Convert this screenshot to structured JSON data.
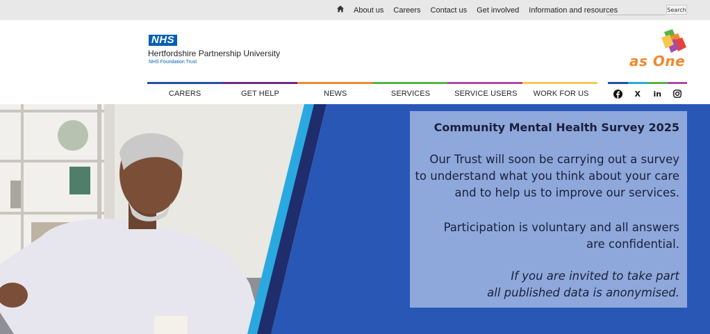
{
  "topbar": {
    "links": [
      "About us",
      "Careers",
      "Contact us",
      "Get involved",
      "Information and resources"
    ],
    "search_placeholder": "",
    "search_button": "Search"
  },
  "header": {
    "nhs_logo": "NHS",
    "org_name": "Hertfordshire Partnership University",
    "org_sub": "NHS Foundation Trust",
    "partner_logo": "as One"
  },
  "colors": {
    "bar": [
      "#2151a6",
      "#6d2a84",
      "#ef8a2c",
      "#57b345",
      "#a64ca6",
      "#f6c851"
    ],
    "bar2": [
      "#2151a6",
      "#2aa9e0",
      "#57b345",
      "#a64ca6"
    ],
    "hero_bg": "#2857b6",
    "panel_bg": "#8ea8db",
    "stripe": "#2aa9e0"
  },
  "nav": {
    "items": [
      "CARERS",
      "GET HELP",
      "NEWS",
      "SERVICES",
      "SERVICE USERS",
      "WORK FOR US"
    ]
  },
  "social": {
    "icons": [
      "facebook-icon",
      "x-icon",
      "linkedin-icon",
      "instagram-icon"
    ],
    "labels": [
      "",
      "X",
      "in",
      ""
    ]
  },
  "hero": {
    "title": "Community Mental Health Survey 2025",
    "p1": [
      "Our Trust will soon be carrying out a survey",
      "to understand what you think about your care",
      "and to help us to improve our services."
    ],
    "p2": [
      "Participation is voluntary and all answers",
      "are confidential."
    ],
    "p3": [
      "If you are invited to take part",
      "all published data is anonymised."
    ]
  }
}
